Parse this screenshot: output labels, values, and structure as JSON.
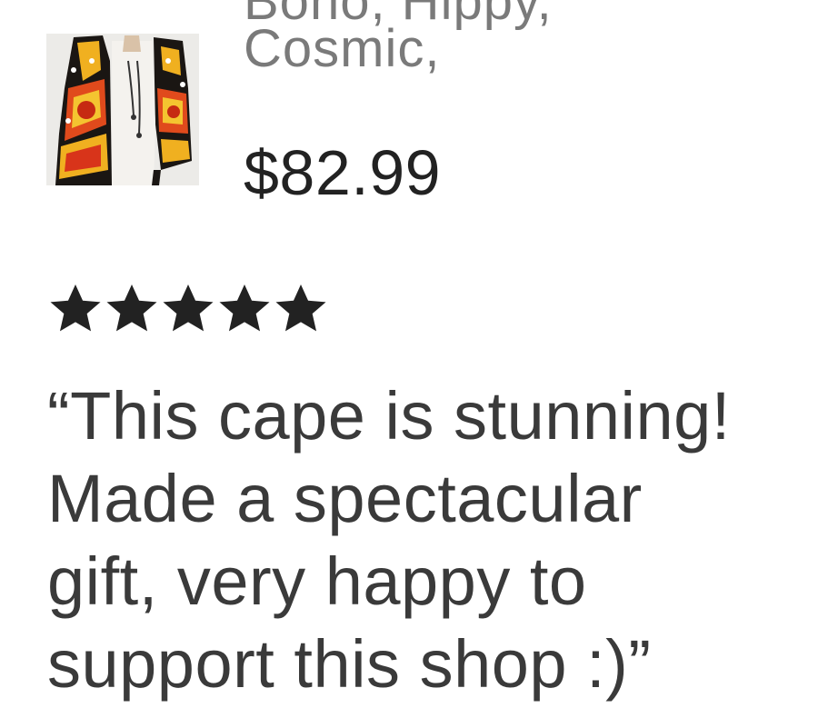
{
  "product": {
    "title_lines": [
      "Boho, Hippy,",
      "Cosmic,"
    ],
    "price": "$82.99",
    "image_icon": "product-thumbnail-cape"
  },
  "review": {
    "rating": 5,
    "rating_max": 5,
    "star_icon": "star-icon",
    "star_color": "#222222",
    "lines": [
      "“This cape is stunning!",
      "Made a spectacular",
      "gift, very happy to",
      "support this shop :)”"
    ]
  }
}
